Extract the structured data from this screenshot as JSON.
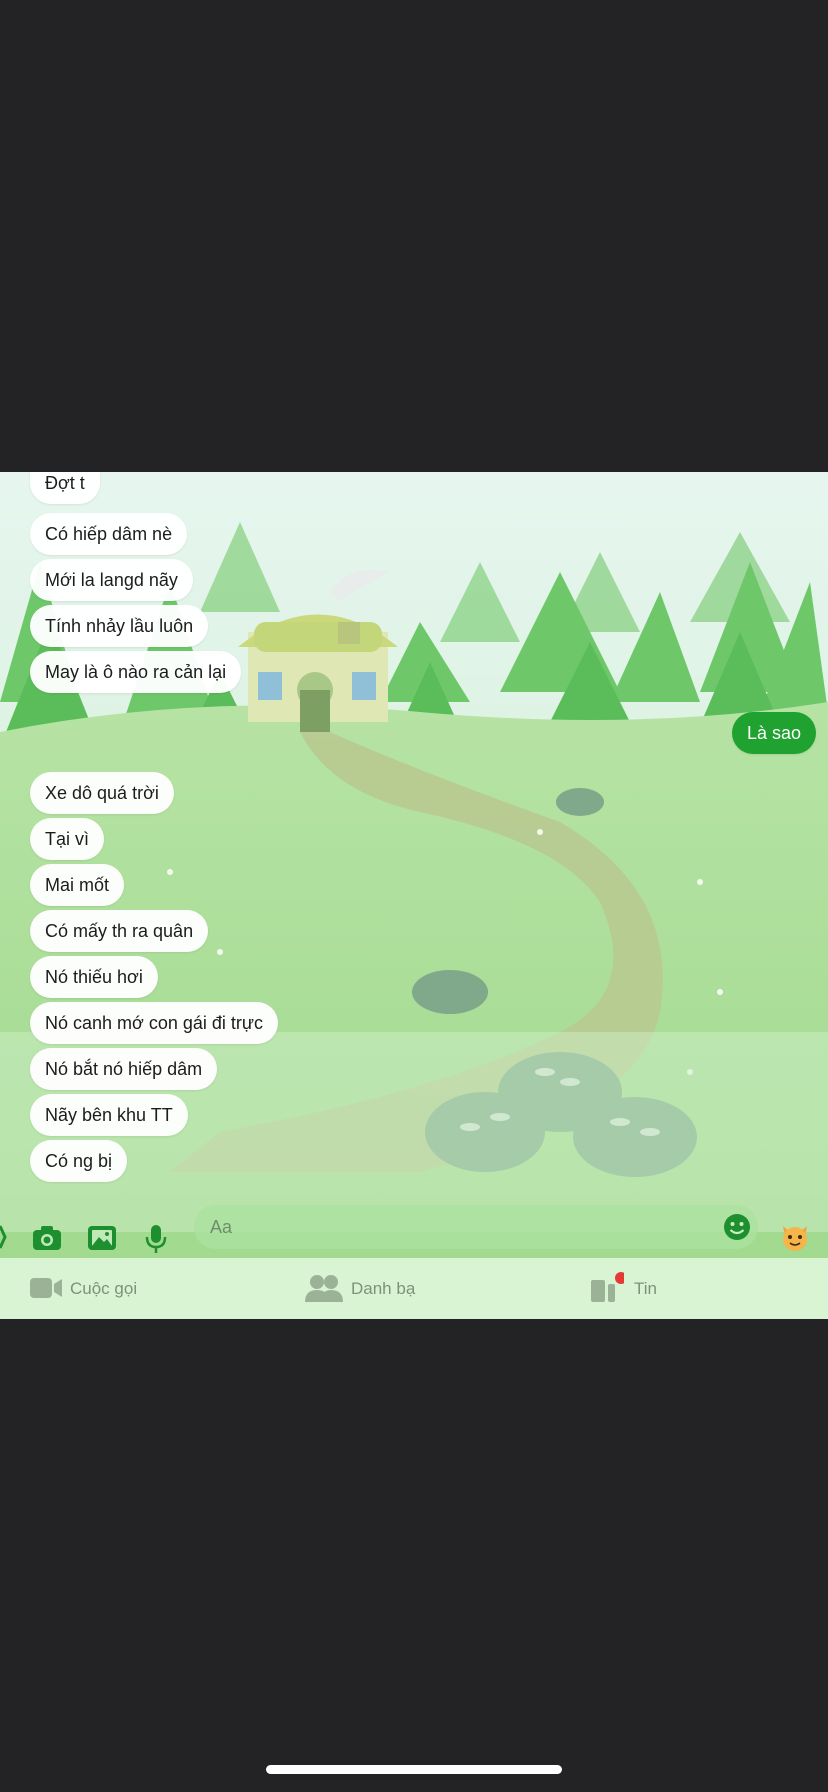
{
  "chat": {
    "messages": [
      {
        "side": "in",
        "text": "Đợt t"
      },
      {
        "side": "in",
        "text": "Có hiếp dâm nè"
      },
      {
        "side": "in",
        "text": "Mới la langd nãy"
      },
      {
        "side": "in",
        "text": "Tính nhảy lầu luôn"
      },
      {
        "side": "in",
        "text": "May là ô nào ra cản lại"
      },
      {
        "side": "out",
        "text": "Là sao"
      },
      {
        "side": "in",
        "text": "Xe dô quá trời"
      },
      {
        "side": "in",
        "text": "Tại vì"
      },
      {
        "side": "in",
        "text": "Mai mốt"
      },
      {
        "side": "in",
        "text": "Có mấy th ra quân"
      },
      {
        "side": "in",
        "text": "Nó thiếu hơi"
      },
      {
        "side": "in",
        "text": "Nó canh mớ con gái đi trực"
      },
      {
        "side": "in",
        "text": "Nó bắt nó hiếp dâm"
      },
      {
        "side": "in",
        "text": "Nãy bên khu TT"
      },
      {
        "side": "in",
        "text": "Có ng bị"
      }
    ]
  },
  "composer": {
    "placeholder": "Aa",
    "icons": [
      "camera-icon",
      "image-icon",
      "microphone-icon",
      "emoji-icon",
      "cat-sticker-icon"
    ]
  },
  "tabbar": {
    "calls_label": "Cuộc gọi",
    "contacts_label": "Danh bạ",
    "news_label": "Tin"
  },
  "colors": {
    "outgoing_bubble": "#1fa22f",
    "accent_green": "#1e8f2e",
    "page_background": "#232326",
    "notification_dot": "#e53935"
  }
}
